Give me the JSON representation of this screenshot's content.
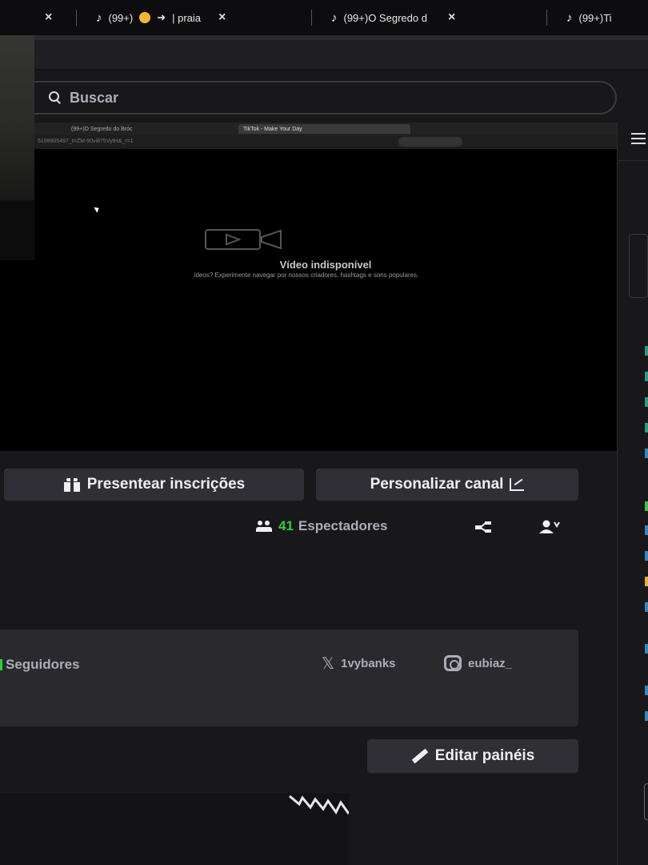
{
  "browser": {
    "tabs": [
      {
        "title": "(99+)",
        "extra": "| praia",
        "close": "×"
      },
      {
        "title": "(99+)O Segredo d",
        "close": "×"
      },
      {
        "title": "(99+)Ti"
      }
    ],
    "leading_close": "×"
  },
  "search": {
    "placeholder": "Buscar"
  },
  "player": {
    "unavailable_title": "Vídeo indisponível",
    "unavailable_subtitle": "ideos? Experimente navegar por nossos criadores, hashtags e sons populares.",
    "inner_tabs": [
      "(99+)O Segredo do Bróc",
      "TikTok - Make Your Day"
    ],
    "inner_url": "5199905497_t=ZM-90vi875VytH&_r=1"
  },
  "actions": {
    "gift_label": "Presentear inscrições",
    "customize_label": "Personalizar canal"
  },
  "stats": {
    "viewer_count": "41",
    "viewer_label": "Espectadores"
  },
  "about": {
    "followers_label": "Seguidores",
    "twitter_handle": "1vybanks",
    "instagram_handle": "eubiaz_"
  },
  "panels": {
    "edit_label": "Editar painéis"
  },
  "colors": {
    "accent_green": "#2ecc40",
    "chat_badge_blue": "#1f8ed6",
    "chat_badge_teal": "#18a38c",
    "chat_badge_gold": "#f2b01e"
  }
}
